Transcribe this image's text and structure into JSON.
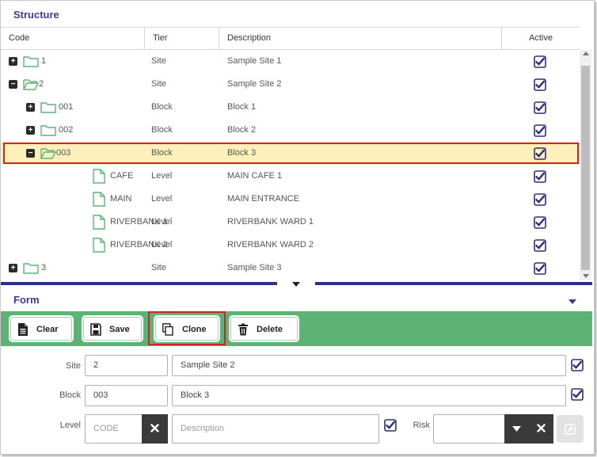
{
  "structure": {
    "title": "Structure",
    "columns": {
      "code": "Code",
      "tier": "Tier",
      "description": "Description",
      "active": "Active"
    },
    "rows": [
      {
        "code": "1",
        "tier": "Site",
        "description": "Sample Site 1",
        "toggle": "+",
        "node": "folder-closed",
        "selected": false
      },
      {
        "code": "2",
        "tier": "Site",
        "description": "Sample Site 2",
        "toggle": "−",
        "node": "folder-open",
        "selected": false
      },
      {
        "code": "001",
        "tier": "Block",
        "description": "Block 1",
        "toggle": "+",
        "node": "folder-closed",
        "selected": false
      },
      {
        "code": "002",
        "tier": "Block",
        "description": "Block 2",
        "toggle": "+",
        "node": "folder-closed",
        "selected": false
      },
      {
        "code": "003",
        "tier": "Block",
        "description": "Block 3",
        "toggle": "−",
        "node": "folder-open",
        "selected": true
      },
      {
        "code": "CAFE",
        "tier": "Level",
        "description": "MAIN CAFE 1",
        "toggle": "",
        "node": "file",
        "selected": false
      },
      {
        "code": "MAIN",
        "tier": "Level",
        "description": "MAIN ENTRANCE",
        "toggle": "",
        "node": "file",
        "selected": false
      },
      {
        "code": "RIVERBANK 1",
        "tier": "Level",
        "description": "RIVERBANK WARD 1",
        "toggle": "",
        "node": "file",
        "selected": false
      },
      {
        "code": "RIVERBANK 2",
        "tier": "Level",
        "description": "RIVERBANK WARD 2",
        "toggle": "",
        "node": "file",
        "selected": false
      },
      {
        "code": "3",
        "tier": "Site",
        "description": "Sample Site 3",
        "toggle": "+",
        "node": "folder-closed",
        "selected": false
      }
    ]
  },
  "form": {
    "title": "Form",
    "toolbar": {
      "clear_label": "Clear",
      "save_label": "Save",
      "clone_label": "Clone",
      "delete_label": "Delete"
    },
    "site": {
      "label": "Site",
      "code": "2",
      "description": "Sample Site 2",
      "active": true
    },
    "block": {
      "label": "Block",
      "code": "003",
      "description": "Block 3",
      "active": true
    },
    "level": {
      "label": "Level",
      "code_placeholder": "CODE",
      "description_placeholder": "Description",
      "active": true
    },
    "risk": {
      "label": "Risk",
      "value": ""
    }
  },
  "colors": {
    "accent": "#3b3a8f",
    "toolbar_green": "#5db376",
    "selection_bg": "#fdf0bb",
    "highlight_red": "#d32222",
    "folder_green": "#5db376"
  }
}
